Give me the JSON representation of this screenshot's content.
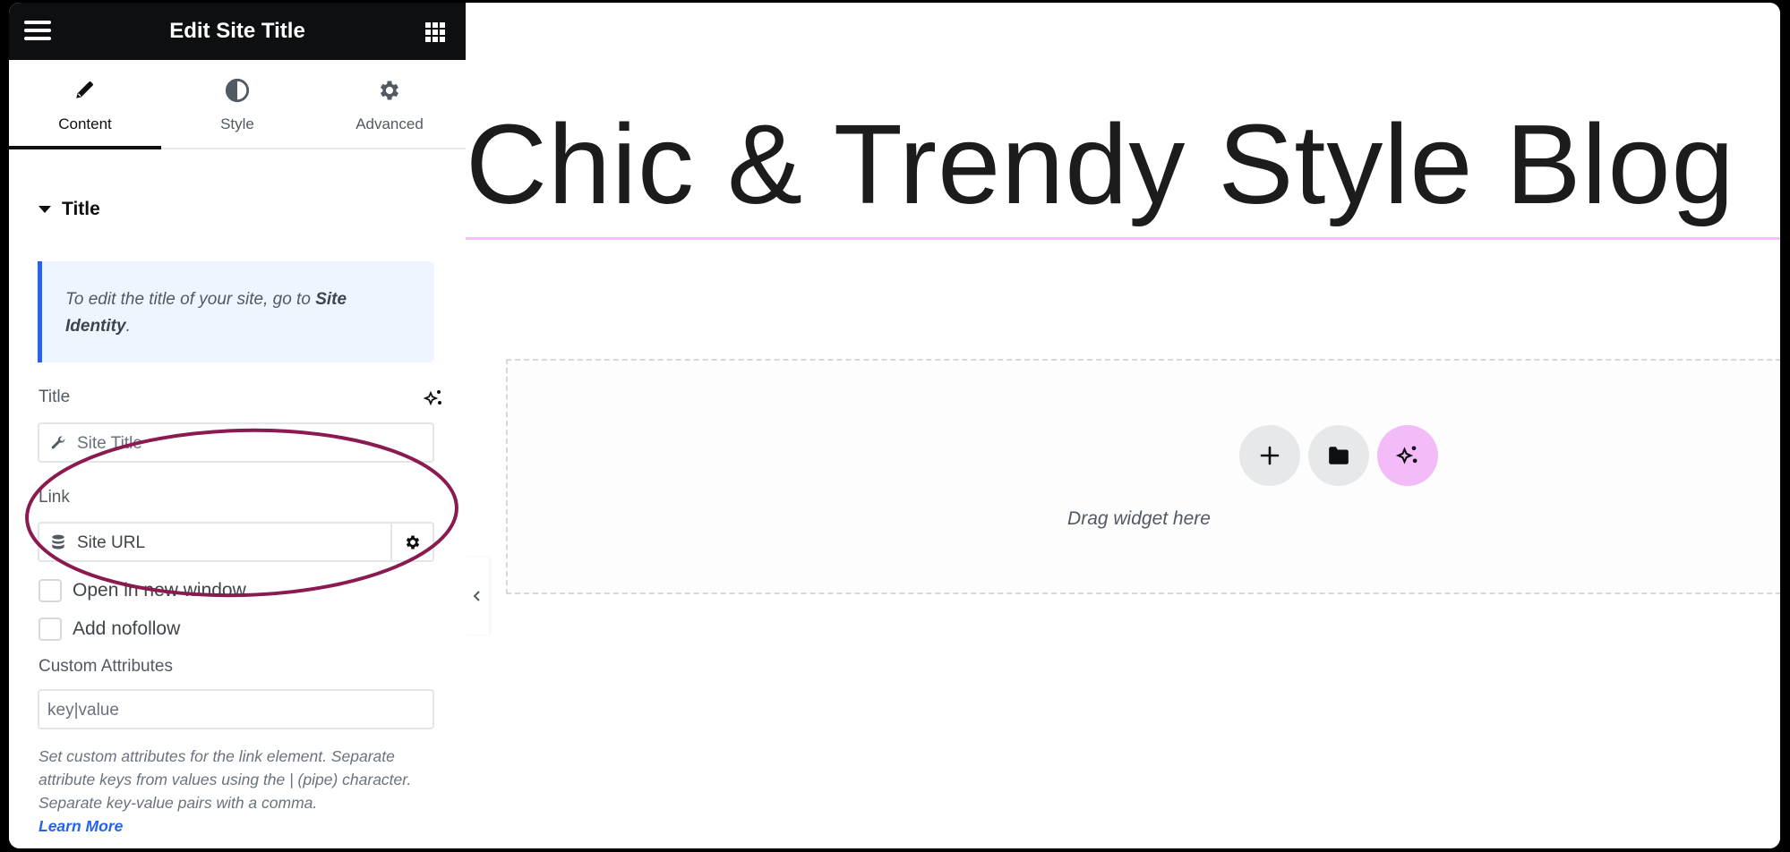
{
  "panel": {
    "header": {
      "title": "Edit Site Title",
      "menu_icon": "hamburger-icon",
      "apps_icon": "grid-icon"
    },
    "tabs": [
      {
        "label": "Content",
        "icon": "pencil-icon",
        "active": true
      },
      {
        "label": "Style",
        "icon": "contrast-icon",
        "active": false
      },
      {
        "label": "Advanced",
        "icon": "gear-icon",
        "active": false
      }
    ],
    "section": {
      "title": "Title",
      "expanded": true
    },
    "info_notice": {
      "text": "To edit the title of your site, go to ",
      "bold_link": "Site Identity",
      "suffix": "."
    },
    "title_control": {
      "label": "Title",
      "value": "Site Title",
      "dynamic_icon": "wrench-icon",
      "ai_icon": "sparkle-icon"
    },
    "link_control": {
      "label": "Link",
      "value": "Site URL",
      "dynamic_icon": "database-icon",
      "settings_icon": "gear-icon"
    },
    "checkboxes": [
      {
        "label": "Open in new window",
        "checked": false
      },
      {
        "label": "Add nofollow",
        "checked": false
      }
    ],
    "custom_attributes": {
      "label": "Custom Attributes",
      "placeholder": "key|value",
      "help": "Set custom attributes for the link element. Separate attribute keys from values using the | (pipe) character. Separate key-value pairs with a comma.",
      "learn_more": "Learn More"
    }
  },
  "canvas": {
    "site_title": "Chic & Trendy Style Blog",
    "dropzone": {
      "buttons": [
        {
          "name": "add-section",
          "icon": "plus-icon"
        },
        {
          "name": "templates",
          "icon": "folder-icon"
        },
        {
          "name": "ai-builder",
          "icon": "sparkle-icon"
        }
      ],
      "text": "Drag widget here"
    },
    "collapse_icon": "chevron-left-icon"
  },
  "colors": {
    "header_bg": "#0e0f11",
    "accent_blue": "#2563eb",
    "annotation": "#8a1a4f",
    "ai_pink": "#f3bcf9",
    "highlight_line": "#f0c1f5"
  }
}
